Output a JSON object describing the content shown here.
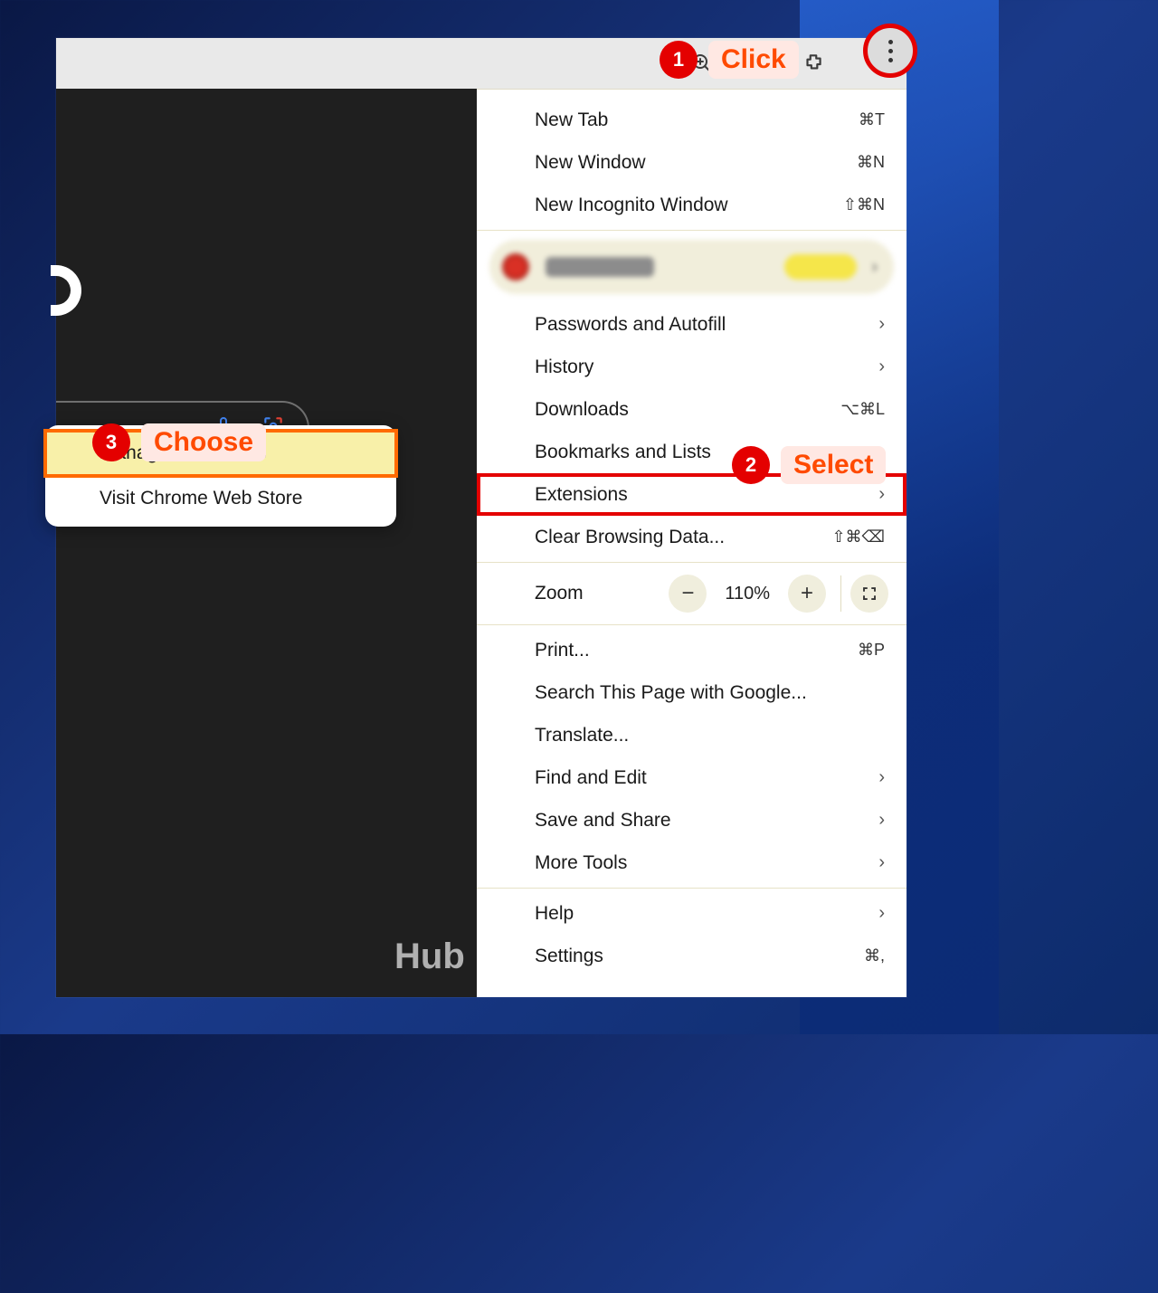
{
  "callouts": {
    "c1": {
      "num": "1",
      "text": "Click"
    },
    "c2": {
      "num": "2",
      "text": "Select"
    },
    "c3": {
      "num": "3",
      "text": "Choose"
    }
  },
  "menu": {
    "new_tab": {
      "label": "New Tab",
      "shortcut": "⌘T"
    },
    "new_window": {
      "label": "New Window",
      "shortcut": "⌘N"
    },
    "incognito": {
      "label": "New Incognito Window",
      "shortcut": "⇧⌘N"
    },
    "passwords": {
      "label": "Passwords and Autofill"
    },
    "history": {
      "label": "History"
    },
    "downloads": {
      "label": "Downloads",
      "shortcut": "⌥⌘L"
    },
    "bookmarks": {
      "label": "Bookmarks and Lists"
    },
    "extensions": {
      "label": "Extensions"
    },
    "clear": {
      "label": "Clear Browsing Data...",
      "shortcut": "⇧⌘⌫"
    },
    "zoom": {
      "label": "Zoom",
      "value": "110%"
    },
    "print": {
      "label": "Print...",
      "shortcut": "⌘P"
    },
    "search_google": {
      "label": "Search This Page with Google..."
    },
    "translate": {
      "label": "Translate..."
    },
    "find_edit": {
      "label": "Find and Edit"
    },
    "save_share": {
      "label": "Save and Share"
    },
    "more_tools": {
      "label": "More Tools"
    },
    "help": {
      "label": "Help"
    },
    "settings": {
      "label": "Settings",
      "shortcut": "⌘,"
    }
  },
  "submenu": {
    "manage": {
      "label": "Manage Extensions"
    },
    "store": {
      "label": "Visit Chrome Web Store"
    }
  },
  "watermark": "Hub"
}
